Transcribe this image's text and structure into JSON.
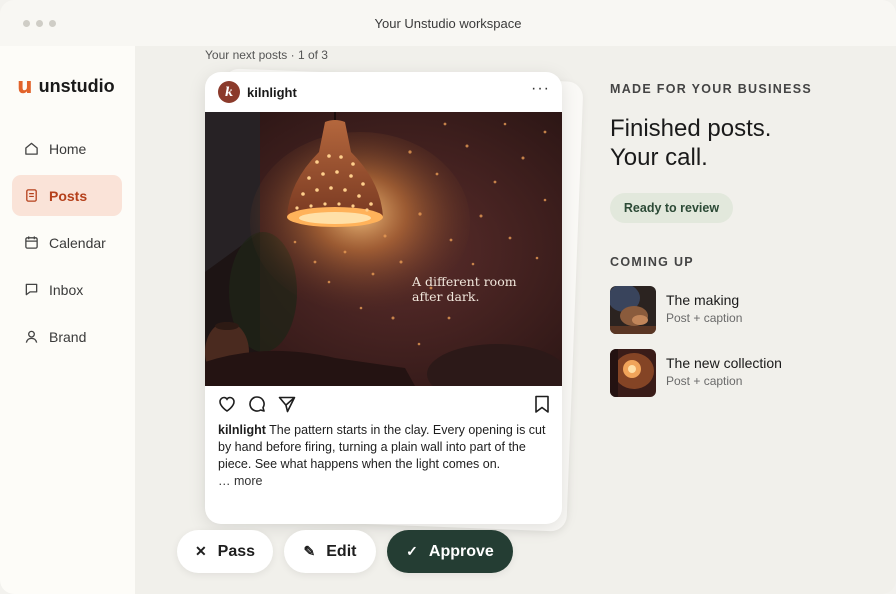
{
  "window": {
    "title": "Your Unstudio workspace"
  },
  "brand": {
    "mark": "u",
    "name": "unstudio",
    "accent": "#e2632b"
  },
  "nav": [
    {
      "label": "Home",
      "icon": "home-icon",
      "active": false
    },
    {
      "label": "Posts",
      "icon": "posts-icon",
      "active": true
    },
    {
      "label": "Calendar",
      "icon": "calendar-icon",
      "active": false
    },
    {
      "label": "Inbox",
      "icon": "inbox-icon",
      "active": false
    },
    {
      "label": "Brand",
      "icon": "user-icon",
      "active": false
    }
  ],
  "queue": {
    "label": "Your next posts · 1 of 3"
  },
  "post": {
    "avatar_letter": "k",
    "username": "kilnlight",
    "more": "···",
    "image_text_line1": "A different room",
    "image_text_line2": "after dark.",
    "caption_user": "kilnlight",
    "caption": " The pattern starts in the clay. Every opening is cut by hand before firing, turning a plain wall into part of the piece. See what happens when the light comes on.",
    "more_label": "… more"
  },
  "buttons": {
    "pass": "Pass",
    "edit": "Edit",
    "approve": "Approve",
    "approve_color": "#243d33"
  },
  "panel": {
    "kicker": "MADE FOR YOUR BUSINESS",
    "headline_line1": "Finished posts.",
    "headline_line2": "Your call.",
    "status": "Ready to review",
    "coming_up": "COMING UP",
    "upcoming": [
      {
        "title": "The making",
        "subtitle": "Post + caption"
      },
      {
        "title": "The new collection",
        "subtitle": "Post + caption"
      }
    ]
  }
}
